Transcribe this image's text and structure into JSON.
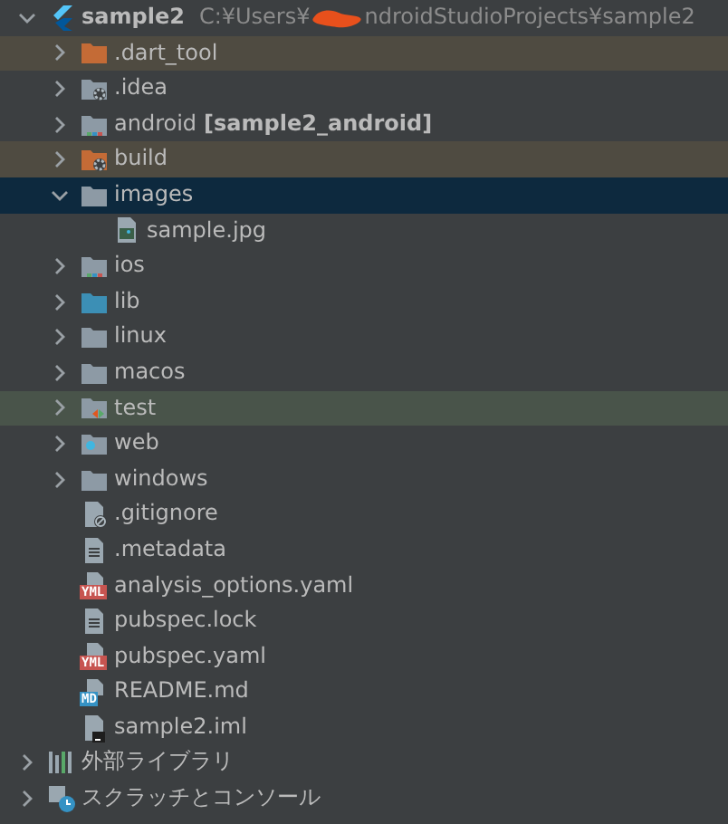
{
  "tree": [
    {
      "label": "sample2",
      "kind": "flutter-module",
      "expanded": true,
      "selected": false,
      "path_start": "C:¥Users¥",
      "path_end": "ndroidStudioProjects¥sample2",
      "children": [
        {
          "label": ".dart_tool",
          "kind": "folder",
          "excluded": true,
          "expanded": false,
          "selected": false
        },
        {
          "label": ".idea",
          "kind": "config-folder",
          "expanded": false,
          "selected": false
        },
        {
          "label": "android",
          "suffix": "[sample2_android]",
          "kind": "module-folder",
          "expanded": false,
          "selected": false
        },
        {
          "label": "build",
          "kind": "config-folder",
          "excluded": true,
          "expanded": false,
          "selected": false
        },
        {
          "label": "images",
          "kind": "folder",
          "expanded": true,
          "selected": true,
          "children": [
            {
              "label": "sample.jpg",
              "kind": "image-file",
              "selected": false
            }
          ]
        },
        {
          "label": "ios",
          "kind": "module-folder",
          "expanded": false,
          "selected": false
        },
        {
          "label": "lib",
          "kind": "source-folder",
          "expanded": false,
          "selected": false
        },
        {
          "label": "linux",
          "kind": "folder",
          "expanded": false,
          "selected": false
        },
        {
          "label": "macos",
          "kind": "folder",
          "expanded": false,
          "selected": false
        },
        {
          "label": "test",
          "kind": "test-folder",
          "expanded": false,
          "selected": false
        },
        {
          "label": "web",
          "kind": "web-folder",
          "expanded": false,
          "selected": false
        },
        {
          "label": "windows",
          "kind": "folder",
          "expanded": false,
          "selected": false
        },
        {
          "label": ".gitignore",
          "kind": "ignore-file",
          "selected": false
        },
        {
          "label": ".metadata",
          "kind": "text-file",
          "selected": false
        },
        {
          "label": "analysis_options.yaml",
          "kind": "badge-file",
          "badge": "YML",
          "color": "#c75450",
          "selected": false
        },
        {
          "label": "pubspec.lock",
          "kind": "text-file",
          "selected": false
        },
        {
          "label": "pubspec.yaml",
          "kind": "badge-file",
          "badge": "YML",
          "color": "#c75450",
          "selected": false
        },
        {
          "label": "README.md",
          "kind": "badge-file",
          "badge": "MD",
          "color": "#3592c4",
          "selected": false
        },
        {
          "label": "sample2.iml",
          "kind": "module-file",
          "selected": false
        }
      ]
    },
    {
      "label": "外部ライブラリ",
      "kind": "libraries",
      "expanded": false,
      "selected": false
    },
    {
      "label": "スクラッチとコンソール",
      "kind": "scratches",
      "expanded": false,
      "selected": false
    }
  ]
}
